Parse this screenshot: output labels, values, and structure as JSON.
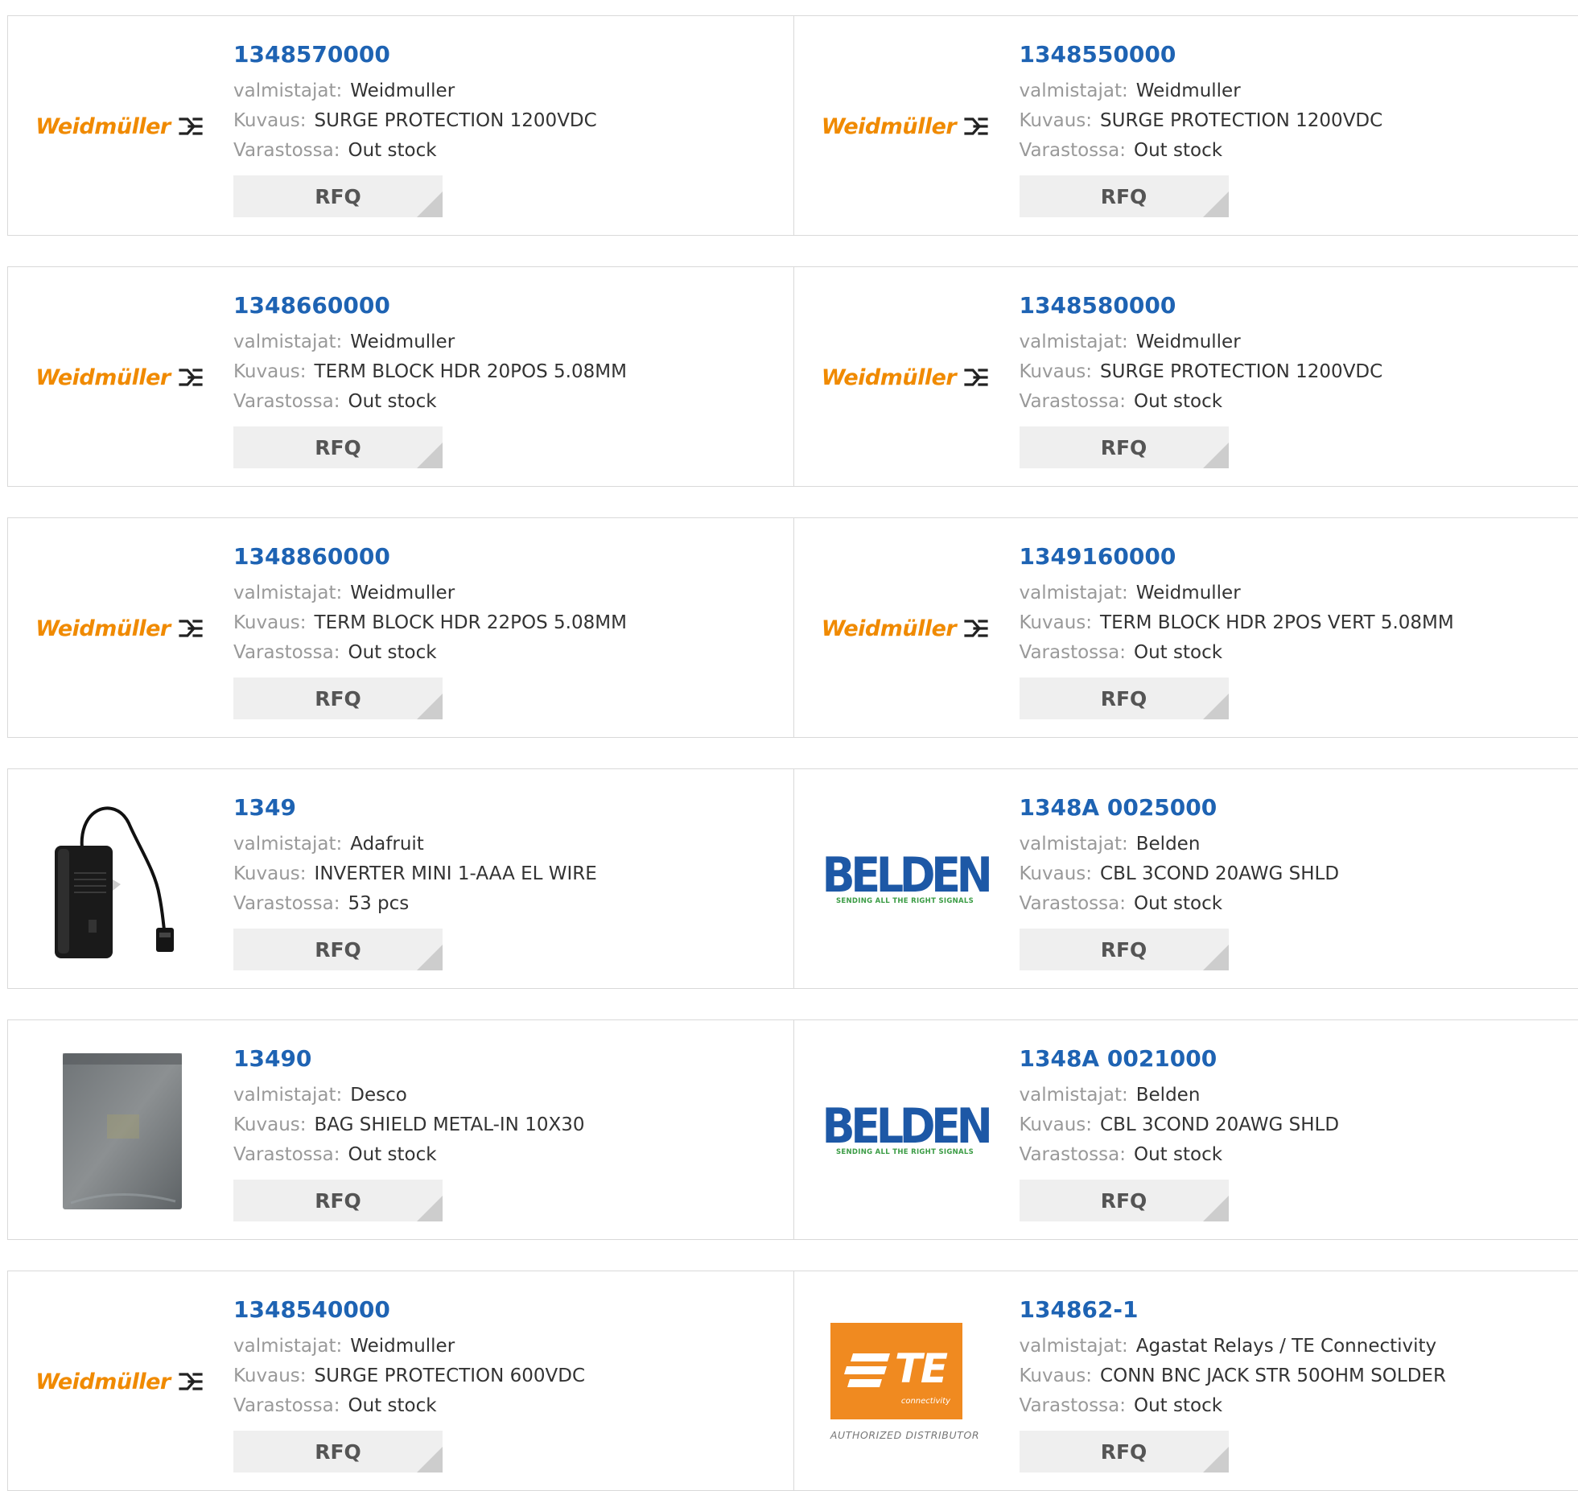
{
  "labels": {
    "manufacturer": "valmistajat:",
    "description": "Kuvaus:",
    "stock": "Varastossa:",
    "rfq": "RFQ"
  },
  "brands": {
    "weidmuller_logo": "Weidmüller",
    "belden_logo": "BELDEN",
    "belden_tagline": "SENDING ALL THE RIGHT SIGNALS",
    "te_logo": "TE",
    "te_sub": "connectivity",
    "te_authorized": "AUTHORIZED DISTRIBUTOR"
  },
  "colors": {
    "link": "#1e63b3",
    "weidmuller": "#f08a00",
    "belden": "#1d58a6",
    "te": "#f08a20",
    "rfq_bg": "#efefef"
  },
  "products": [
    {
      "part": "1348570000",
      "manufacturer": "Weidmuller",
      "description": "SURGE PROTECTION 1200VDC",
      "stock": "Out stock",
      "image": "weidmuller-logo"
    },
    {
      "part": "1348550000",
      "manufacturer": "Weidmuller",
      "description": "SURGE PROTECTION 1200VDC",
      "stock": "Out stock",
      "image": "weidmuller-logo"
    },
    {
      "part": "1348660000",
      "manufacturer": "Weidmuller",
      "description": "TERM BLOCK HDR 20POS 5.08MM",
      "stock": "Out stock",
      "image": "weidmuller-logo"
    },
    {
      "part": "1348580000",
      "manufacturer": "Weidmuller",
      "description": "SURGE PROTECTION 1200VDC",
      "stock": "Out stock",
      "image": "weidmuller-logo"
    },
    {
      "part": "1348860000",
      "manufacturer": "Weidmuller",
      "description": "TERM BLOCK HDR 22POS 5.08MM",
      "stock": "Out stock",
      "image": "weidmuller-logo"
    },
    {
      "part": "1349160000",
      "manufacturer": "Weidmuller",
      "description": "TERM BLOCK HDR 2POS VERT 5.08MM",
      "stock": "Out stock",
      "image": "weidmuller-logo"
    },
    {
      "part": "1349",
      "manufacturer": "Adafruit",
      "description": "INVERTER MINI 1-AAA EL WIRE",
      "stock": "53 pcs",
      "image": "inverter-photo"
    },
    {
      "part": "1348A 0025000",
      "manufacturer": "Belden",
      "description": "CBL 3COND 20AWG SHLD",
      "stock": "Out stock",
      "image": "belden-logo"
    },
    {
      "part": "13490",
      "manufacturer": "Desco",
      "description": "BAG SHIELD METAL-IN 10X30",
      "stock": "Out stock",
      "image": "shield-bag-photo"
    },
    {
      "part": "1348A 0021000",
      "manufacturer": "Belden",
      "description": "CBL 3COND 20AWG SHLD",
      "stock": "Out stock",
      "image": "belden-logo"
    },
    {
      "part": "1348540000",
      "manufacturer": "Weidmuller",
      "description": "SURGE PROTECTION 600VDC",
      "stock": "Out stock",
      "image": "weidmuller-logo"
    },
    {
      "part": "134862-1",
      "manufacturer": "Agastat Relays / TE Connectivity",
      "description": "CONN BNC JACK STR 50OHM SOLDER",
      "stock": "Out stock",
      "image": "te-logo"
    }
  ]
}
